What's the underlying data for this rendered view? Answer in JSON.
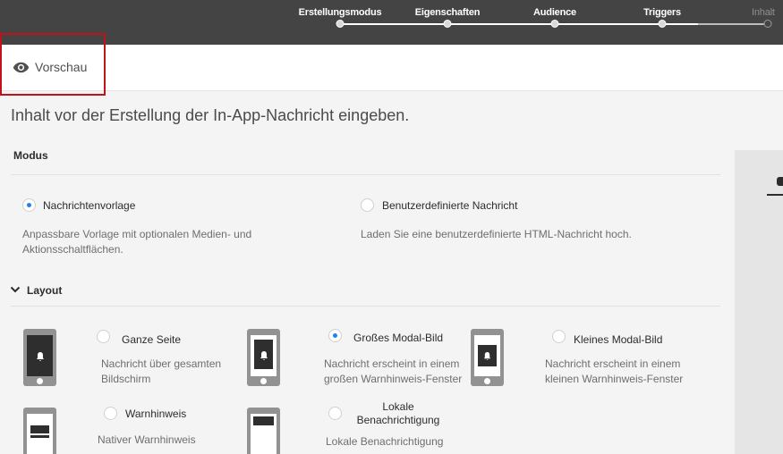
{
  "stepper": {
    "steps": [
      {
        "label": "Erstellungsmodus",
        "state": "done"
      },
      {
        "label": "Eigenschaften",
        "state": "done"
      },
      {
        "label": "Audience",
        "state": "done"
      },
      {
        "label": "Triggers",
        "state": "done"
      },
      {
        "label": "Inhalt",
        "state": "current"
      }
    ]
  },
  "preview": {
    "label": "Vorschau",
    "icon": "eye-icon"
  },
  "intro": "Inhalt vor der Erstellung der In-App-Nachricht eingeben.",
  "modus": {
    "title": "Modus",
    "options": [
      {
        "label": "Nachrichtenvorlage",
        "desc": "Anpassbare Vorlage mit optionalen Medien- und Aktionsschaltflächen.",
        "selected": true
      },
      {
        "label": "Benutzerdefinierte Nachricht",
        "desc": "Laden Sie eine benutzerdefinierte HTML-Nachricht hoch.",
        "selected": false
      }
    ]
  },
  "layout": {
    "title": "Layout",
    "options": [
      {
        "label": "Ganze Seite",
        "desc": "Nachricht über gesamten Bildschirm",
        "selected": false,
        "icon": "fullscreen-phone-icon"
      },
      {
        "label": "Großes Modal-Bild",
        "desc": "Nachricht erscheint in einem großen Warnhinweis-Fenster",
        "selected": true,
        "icon": "large-modal-phone-icon"
      },
      {
        "label": "Kleines Modal-Bild",
        "desc": "Nachricht erscheint in einem kleinen Warnhinweis-Fenster",
        "selected": false,
        "icon": "small-modal-phone-icon"
      },
      {
        "label": "Warnhinweis",
        "desc": "Nativer Warnhinweis",
        "selected": false,
        "icon": "alert-phone-icon"
      },
      {
        "label": "Lokale Benachrichtigung",
        "desc": "Lokale Benachrichtigung",
        "selected": false,
        "icon": "local-notification-phone-icon"
      }
    ]
  },
  "colors": {
    "topbar": "#444444",
    "accent": "#2680eb",
    "highlight": "#c0121b"
  }
}
